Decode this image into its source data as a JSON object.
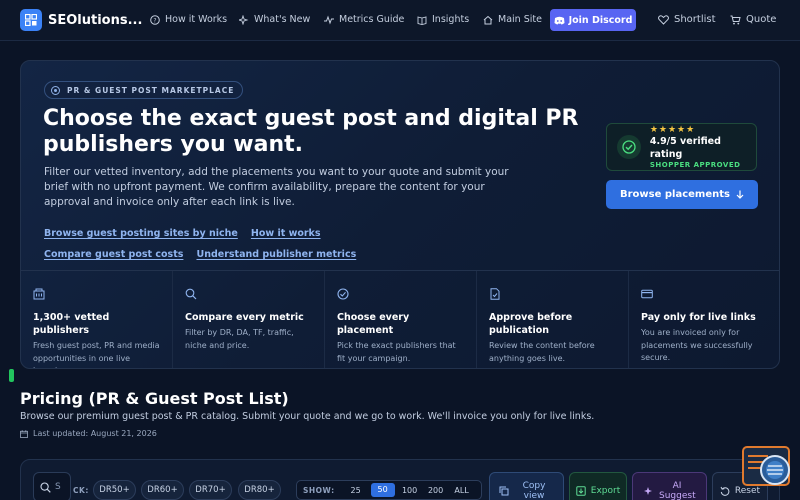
{
  "nav": {
    "brand": "SEOlutions...",
    "items": [
      "How it Works",
      "What's New",
      "Metrics Guide",
      "Insights",
      "Main Site"
    ],
    "discord": "Join Discord",
    "shortlist": "Shortlist",
    "quote": "Quote"
  },
  "hero": {
    "badge": "PR & GUEST POST MARKETPLACE",
    "title": "Choose the exact guest post and digital PR publishers you want.",
    "description": "Filter our vetted inventory, add the placements you want to your quote and submit your brief with no upfront payment. We confirm availability, prepare the content for your approval and invoice only after each link is live.",
    "links": [
      "Browse guest posting sites by niche",
      "How it works",
      "Compare guest post costs",
      "Understand publisher metrics"
    ],
    "rating": {
      "stars": "★★★★★",
      "text": "4.9/5 verified rating",
      "sub": "SHOPPER APPROVED"
    },
    "browse_button": "Browse placements",
    "features": [
      {
        "icon": "building-icon",
        "title": "1,300+ vetted publishers",
        "desc": "Fresh guest post, PR and media opportunities in one live inventory."
      },
      {
        "icon": "search-icon",
        "title": "Compare every metric",
        "desc": "Filter by DR, DA, TF, traffic, niche and price."
      },
      {
        "icon": "check-circle-icon",
        "title": "Choose every placement",
        "desc": "Pick the exact publishers that fit your campaign."
      },
      {
        "icon": "document-icon",
        "title": "Approve before publication",
        "desc": "Review the content before anything goes live."
      },
      {
        "icon": "credit-card-icon",
        "title": "Pay only for live links",
        "desc": "You are invoiced only for placements we successfully secure."
      }
    ]
  },
  "pricing": {
    "title": "Pricing (PR & Guest Post List)",
    "subtitle": "Browse our premium guest post & PR catalog. Submit your quote and we go to work. We'll invoice you only for live links.",
    "updated": "Last updated: August 21, 2026"
  },
  "toolbar": {
    "search_placeholder": "S",
    "quick_label": "CK:",
    "chips": [
      "DR50+",
      "DR60+",
      "DR70+",
      "DR80+"
    ],
    "show_label": "SHOW:",
    "show_options": [
      "25",
      "50",
      "100",
      "200",
      "ALL"
    ],
    "show_selected": "50",
    "copy": "Copy view",
    "export": "Export",
    "ai": "AI Suggest",
    "reset": "Reset"
  },
  "colors": {
    "accent": "#2f6fe0",
    "discord": "#5865f2",
    "success": "#4ade80",
    "star": "#f5c542"
  }
}
